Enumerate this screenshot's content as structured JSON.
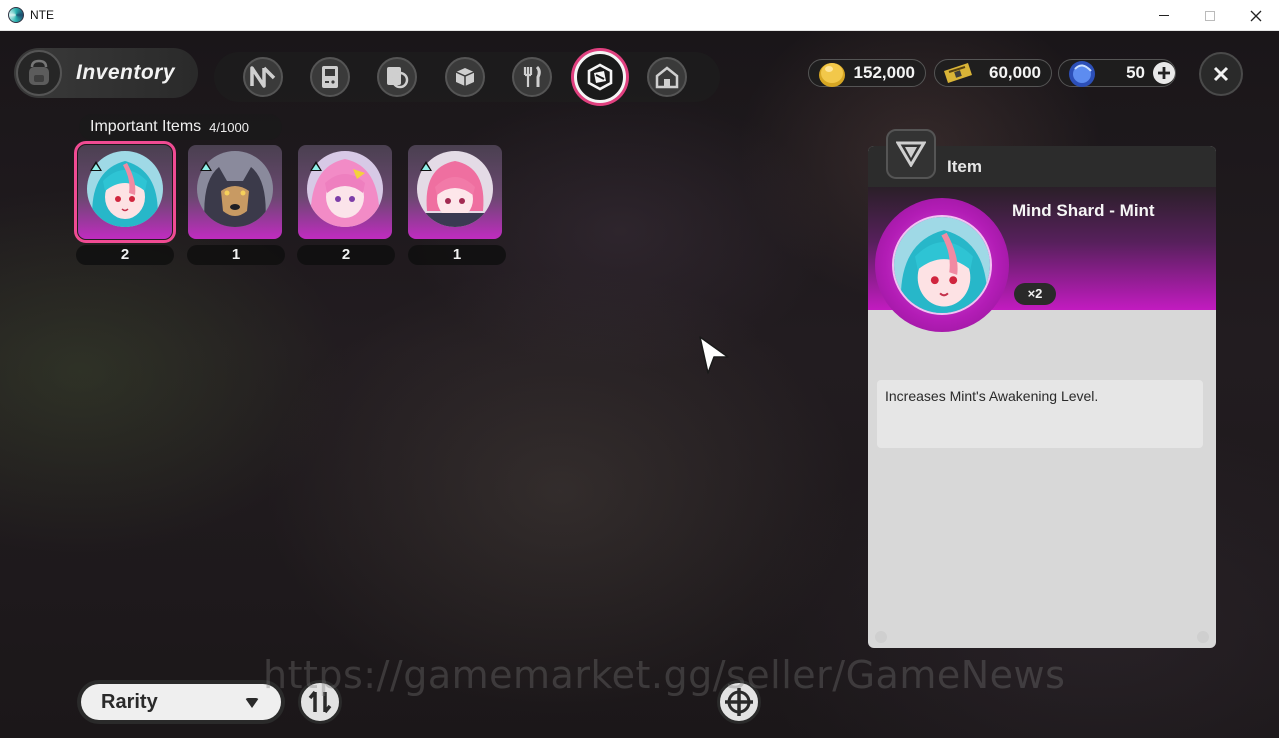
{
  "window": {
    "title": "NTE"
  },
  "header": {
    "title": "Inventory"
  },
  "tabs": [
    {
      "icon": "n-logo-icon"
    },
    {
      "icon": "handheld-console-icon"
    },
    {
      "icon": "tablet-icon"
    },
    {
      "icon": "box-icon"
    },
    {
      "icon": "fork-knife-icon"
    },
    {
      "icon": "important-items-icon",
      "active": true
    },
    {
      "icon": "home-icon"
    }
  ],
  "currency": [
    {
      "icon": "gold-coin-icon",
      "value": "152,000"
    },
    {
      "icon": "ticket-icon",
      "value": "60,000"
    },
    {
      "icon": "blue-crystal-icon",
      "value": "50"
    }
  ],
  "items_section": {
    "label": "Important Items",
    "count": "4/1000"
  },
  "items": [
    {
      "qty": "2",
      "selected": true,
      "icon": "mint-portrait"
    },
    {
      "qty": "1",
      "selected": false,
      "icon": "wolf-portrait"
    },
    {
      "qty": "2",
      "selected": false,
      "icon": "pink-hair-portrait"
    },
    {
      "qty": "1",
      "selected": false,
      "icon": "pink-short-hair-portrait"
    }
  ],
  "detail": {
    "header_label": "Item",
    "name": "Mind Shard - Mint",
    "quantity_badge": "×2",
    "description": "Increases Mint's Awakening Level."
  },
  "sort": {
    "selected": "Rarity"
  },
  "watermark": "https://gamemarket.gg/seller/GameNews",
  "colors": {
    "accent": "#f04b93",
    "rarity": "#c21bc0"
  }
}
